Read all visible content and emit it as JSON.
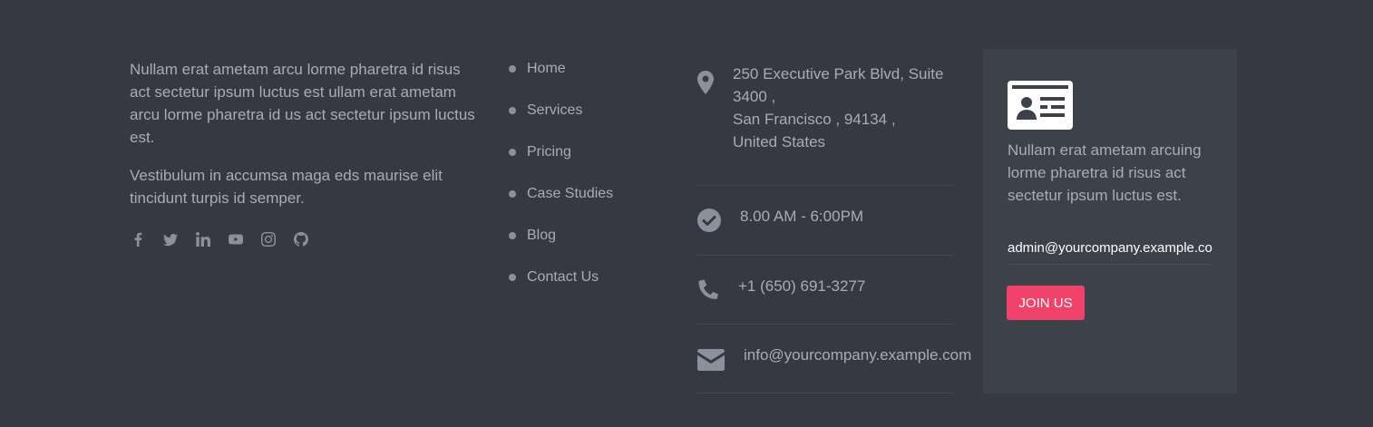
{
  "about": {
    "paragraph1": "Nullam erat ametam arcu lorme pharetra id risus act sectetur ipsum luctus est ullam erat ametam arcu lorme pharetra id us act sectetur ipsum luctus est.",
    "paragraph2": "Vestibulum in accumsa maga eds maurise elit tincidunt turpis id semper."
  },
  "socials": [
    "facebook-icon",
    "twitter-icon",
    "linkedin-icon",
    "youtube-icon",
    "instagram-icon",
    "github-icon"
  ],
  "links": [
    "Home",
    "Services",
    "Pricing",
    "Case Studies",
    "Blog",
    "Contact Us"
  ],
  "contact": {
    "address_line1": "250 Executive Park Blvd, Suite",
    "address_line2": "3400 ,",
    "address_line3": "San Francisco , 94134 ,",
    "address_line4": "United States",
    "hours": "8.00 AM - 6:00PM",
    "phone": "+1 (650) 691-3277",
    "email": "info@yourcompany.example.com"
  },
  "newsletter": {
    "description": "Nullam erat ametam arcuing lorme pharetra id risus act sectetur ipsum luctus est.",
    "email_value": "admin@yourcompany.example.com",
    "button_label": "JOIN US"
  },
  "colors": {
    "background": "#363942",
    "card": "#3d4149",
    "accent": "#f0426b",
    "text": "#a7acb6",
    "icon": "#8b919c"
  }
}
